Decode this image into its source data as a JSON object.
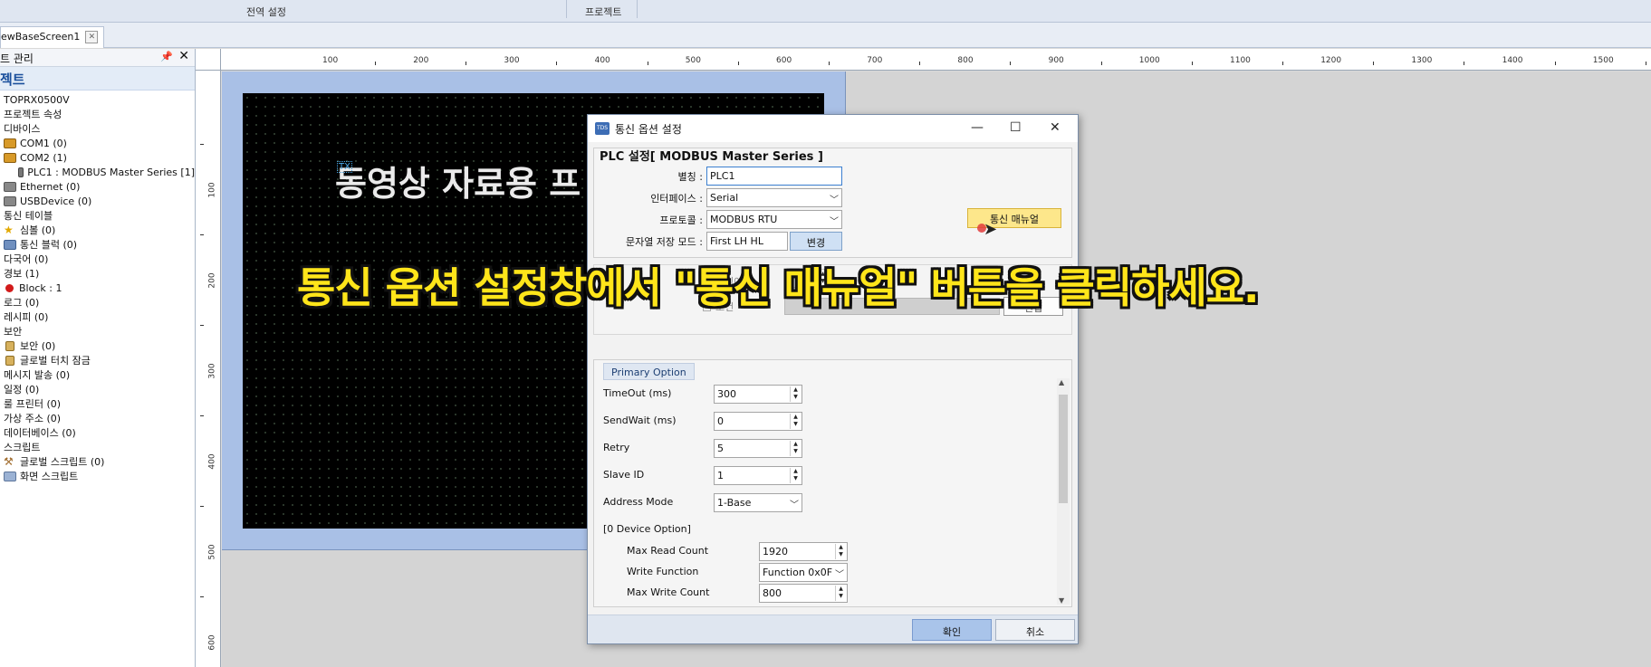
{
  "top_bar": {
    "groups": [
      "전역 설정",
      "프로젝트"
    ]
  },
  "document_tab": {
    "label": "ewBaseScreen1"
  },
  "project_panel": {
    "header": "트 관리",
    "title": "젝트",
    "tree": [
      {
        "label": "TOPRX0500V",
        "icon": ""
      },
      {
        "label": "프로젝트 속성",
        "icon": ""
      },
      {
        "label": "디바이스",
        "icon": ""
      },
      {
        "label": "COM1 (0)",
        "icon": "com-port-icon"
      },
      {
        "label": "COM2 (1)",
        "icon": "com-port-icon"
      },
      {
        "label": "PLC1 : MODBUS Master Series [1]",
        "icon": "plc-icon"
      },
      {
        "label": "Ethernet (0)",
        "icon": "ethernet-icon"
      },
      {
        "label": "USBDevice (0)",
        "icon": "usb-device-icon"
      },
      {
        "label": "통신 테이블",
        "icon": ""
      },
      {
        "label": "심볼 (0)",
        "icon": "star-icon"
      },
      {
        "label": "통신 블럭 (0)",
        "icon": "comm-block-icon"
      },
      {
        "label": "다국어 (0)",
        "icon": ""
      },
      {
        "label": "경보 (1)",
        "icon": ""
      },
      {
        "label": "Block : 1",
        "icon": "alarm-dot-icon"
      },
      {
        "label": "로그 (0)",
        "icon": ""
      },
      {
        "label": "레시피 (0)",
        "icon": ""
      },
      {
        "label": "보안",
        "icon": ""
      },
      {
        "label": "보안 (0)",
        "icon": "lock-icon"
      },
      {
        "label": "글로벌 터치 잠금",
        "icon": "lock-icon"
      },
      {
        "label": "메시지 발송 (0)",
        "icon": ""
      },
      {
        "label": "일정 (0)",
        "icon": ""
      },
      {
        "label": "룰 프린터 (0)",
        "icon": ""
      },
      {
        "label": "가상 주소 (0)",
        "icon": ""
      },
      {
        "label": "데이터베이스 (0)",
        "icon": ""
      },
      {
        "label": "스크립트",
        "icon": ""
      },
      {
        "label": "글로벌 스크립트 (0)",
        "icon": "script-tool-icon"
      },
      {
        "label": "화면 스크립트",
        "icon": "screen-script-icon"
      }
    ]
  },
  "ruler": {
    "h_labels": [
      "100",
      "200",
      "300",
      "400",
      "500",
      "600",
      "700",
      "800",
      "900",
      "1000",
      "1100",
      "1200",
      "1300",
      "1400",
      "1500"
    ],
    "v_labels": [
      "100",
      "200",
      "300",
      "400",
      "500",
      "600"
    ]
  },
  "canvas": {
    "text": "동영상 자료용 프",
    "tx_tag": "TX"
  },
  "dialog": {
    "title": "통신 옵션 설정",
    "app_icon_text": "TDS",
    "plc_group_title": "PLC 설정[ MODBUS Master Series ]",
    "alias_label": "별칭 :",
    "alias_value": "PLC1",
    "interface_label": "인터페이스 :",
    "interface_value": "Serial",
    "protocol_label": "프로토콜 :",
    "protocol_value": "MODBUS RTU",
    "string_mode_label": "문자열 저장 모드 :",
    "string_mode_value": "First LH HL",
    "change_button": "변경",
    "manual_button": "통신 매뉴얼",
    "timeout_check": "타임아웃",
    "condition_check": "조건",
    "edit_button": "편집",
    "primary_tab": "Primary Option",
    "options": [
      {
        "label": "TimeOut (ms)",
        "value": "300",
        "kind": "spin"
      },
      {
        "label": "SendWait (ms)",
        "value": "0",
        "kind": "spin"
      },
      {
        "label": "Retry",
        "value": "5",
        "kind": "spin"
      },
      {
        "label": "Slave ID",
        "value": "1",
        "kind": "spin"
      },
      {
        "label": "Address Mode",
        "value": "1-Base",
        "kind": "combo"
      }
    ],
    "device_option_header": "[0 Device Option]",
    "device_options": [
      {
        "label": "Max Read Count",
        "value": "1920",
        "kind": "spin"
      },
      {
        "label": "Write Function",
        "value": "Function 0x0F",
        "kind": "combo"
      },
      {
        "label": "Max Write Count",
        "value": "800",
        "kind": "spin"
      }
    ],
    "ok_button": "확인",
    "cancel_button": "취소"
  },
  "caption": "통신 옵션 설정창에서 \"통신 매뉴얼\" 버튼을 클릭하세요."
}
